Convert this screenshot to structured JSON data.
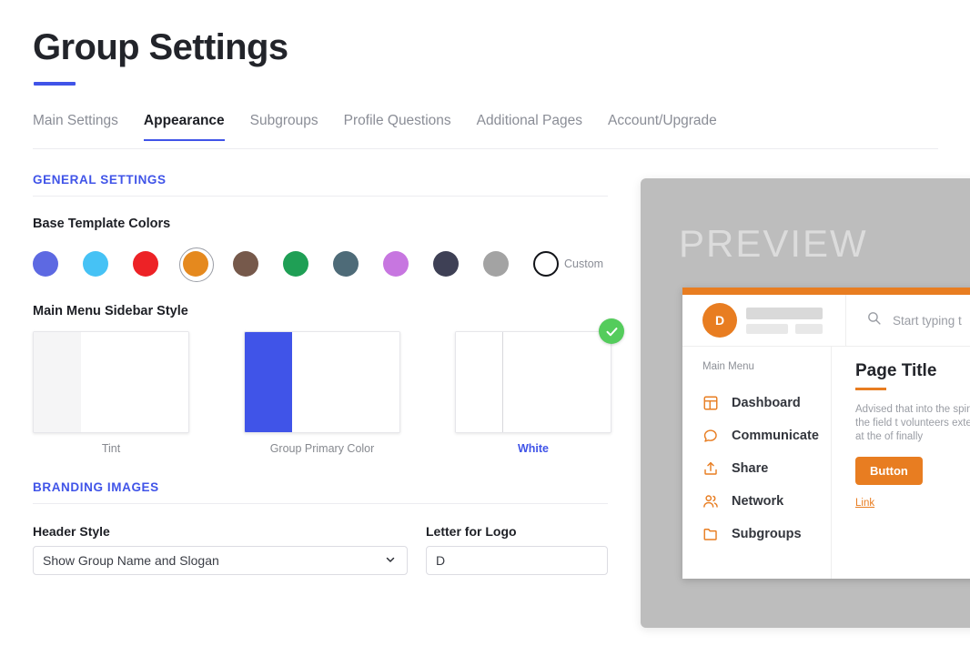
{
  "header": {
    "title": "Group Settings",
    "accent": "#4054e8"
  },
  "tabs": [
    {
      "label": "Main Settings",
      "active": false
    },
    {
      "label": "Appearance",
      "active": true
    },
    {
      "label": "Subgroups",
      "active": false
    },
    {
      "label": "Profile Questions",
      "active": false
    },
    {
      "label": "Additional Pages",
      "active": false
    },
    {
      "label": "Account/Upgrade",
      "active": false
    }
  ],
  "general_settings": {
    "section_title": "GENERAL SETTINGS",
    "base_template_colors": {
      "label": "Base Template Colors",
      "custom_label": "Custom",
      "selected_index": 3,
      "swatches": [
        {
          "name": "indigo",
          "hex": "#5d69e2"
        },
        {
          "name": "sky-blue",
          "hex": "#46c2f5"
        },
        {
          "name": "red",
          "hex": "#ed2226"
        },
        {
          "name": "orange",
          "hex": "#e5891e"
        },
        {
          "name": "brown",
          "hex": "#76594b"
        },
        {
          "name": "green",
          "hex": "#1f9f55"
        },
        {
          "name": "slate-blue",
          "hex": "#4e6b78"
        },
        {
          "name": "orchid",
          "hex": "#c776e0"
        },
        {
          "name": "dark-navy",
          "hex": "#3e4055"
        },
        {
          "name": "gray",
          "hex": "#a3a3a3"
        },
        {
          "name": "custom",
          "hex": "#ffffff"
        }
      ]
    },
    "sidebar_style": {
      "label": "Main Menu Sidebar Style",
      "selected_index": 2,
      "options": [
        {
          "caption": "Tint",
          "strip": "#f5f5f6"
        },
        {
          "caption": "Group Primary Color",
          "strip": "#4054e8"
        },
        {
          "caption": "White",
          "strip": "#ffffff"
        }
      ],
      "check_color": "#54cc5c"
    }
  },
  "branding_images": {
    "section_title": "BRANDING IMAGES",
    "header_style": {
      "label": "Header Style",
      "value": "Show Group Name and Slogan"
    },
    "letter_for_logo": {
      "label": "Letter for Logo",
      "value": "D",
      "placeholder": ""
    }
  },
  "preview": {
    "watermark": "PREVIEW",
    "accent": "#e87d21",
    "avatar_letter": "D",
    "search_placeholder": "Start typing t",
    "menu_title": "Main Menu",
    "menu_items": [
      {
        "label": "Dashboard",
        "icon": "dashboard-icon"
      },
      {
        "label": "Communicate",
        "icon": "chat-bubble-icon"
      },
      {
        "label": "Share",
        "icon": "share-upload-icon"
      },
      {
        "label": "Network",
        "icon": "people-icon"
      },
      {
        "label": "Subgroups",
        "icon": "folder-icon"
      }
    ],
    "content": {
      "title": "Page Title",
      "body": "Advised that into the spineless, the field t volunteers external but at the of finally",
      "button_label": "Button",
      "link_label": "Link"
    }
  }
}
